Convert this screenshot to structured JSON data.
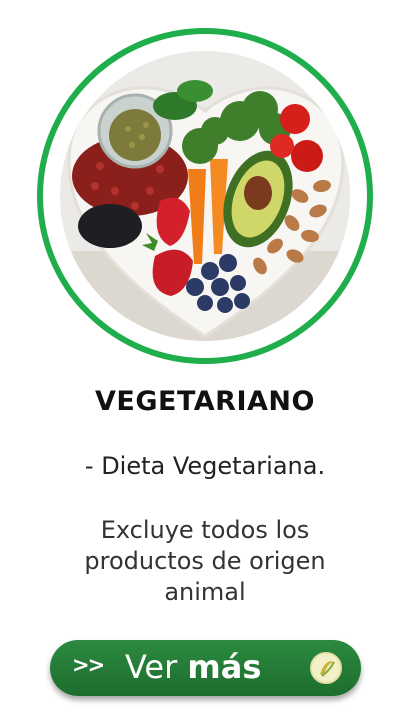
{
  "card": {
    "title": "VEGETARIANO",
    "subtitle": "- Dieta Vegetariana.",
    "description": "Excluye todos los productos de origen animal",
    "cta": {
      "chevrons": ">>",
      "label_regular": "Ver ",
      "label_bold": "más",
      "icon": "brand-logo-icon"
    },
    "image": {
      "icon": "vegetarian-food-heart-bowl-image"
    }
  },
  "colors": {
    "ring": "#1fae4b",
    "button": "#1d6d2e",
    "title": "#111111"
  }
}
